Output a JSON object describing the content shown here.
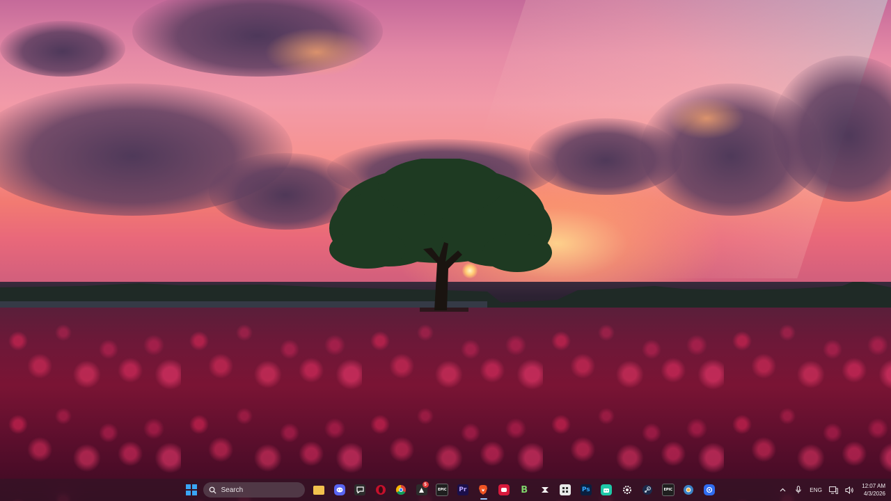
{
  "taskbar": {
    "search": {
      "label": "Search"
    },
    "apps": [
      {
        "id": "file-explorer",
        "glyph": "",
        "color": "#f2c14e"
      },
      {
        "id": "discord",
        "glyph": "",
        "color": "#5865f2"
      },
      {
        "id": "chat-app",
        "glyph": "",
        "color": "#2c2c2c"
      },
      {
        "id": "opera-gx",
        "glyph": "",
        "color": "#c4102c"
      },
      {
        "id": "chrome",
        "glyph": "",
        "color": "#2fa84f"
      },
      {
        "id": "app-notifications",
        "glyph": "",
        "color": "#2c2c2c",
        "badge": "5"
      },
      {
        "id": "epic-games",
        "glyph": "EPIC",
        "color": "#1f1f1f"
      },
      {
        "id": "premiere-pro",
        "glyph": "Pr",
        "color": "#1b0f4a"
      },
      {
        "id": "brave",
        "glyph": "",
        "color": "#f05423"
      },
      {
        "id": "app-red",
        "glyph": "",
        "color": "#d8193c"
      },
      {
        "id": "app-b",
        "glyph": "B",
        "color": "#2d6a2d"
      },
      {
        "id": "app-x",
        "glyph": "",
        "color": "#2a2a2a"
      },
      {
        "id": "app-grid",
        "glyph": "",
        "color": "#e8e8e8"
      },
      {
        "id": "photoshop",
        "glyph": "Ps",
        "color": "#0a1f3f"
      },
      {
        "id": "app-teal",
        "glyph": "",
        "color": "#1fc8a8"
      },
      {
        "id": "app-gear",
        "glyph": "",
        "color": "#2a2a2a"
      },
      {
        "id": "steam",
        "glyph": "",
        "color": "#1b2a4a"
      },
      {
        "id": "epic-games-2",
        "glyph": "EPIC",
        "color": "#1f1f1f"
      },
      {
        "id": "chrome-2",
        "glyph": "",
        "color": "#3b82c4"
      },
      {
        "id": "app-blue",
        "glyph": "",
        "color": "#2f6cf0"
      }
    ],
    "tray": {
      "language": "ENG",
      "time": "12:07 AM",
      "date": "4/3/2026"
    }
  }
}
